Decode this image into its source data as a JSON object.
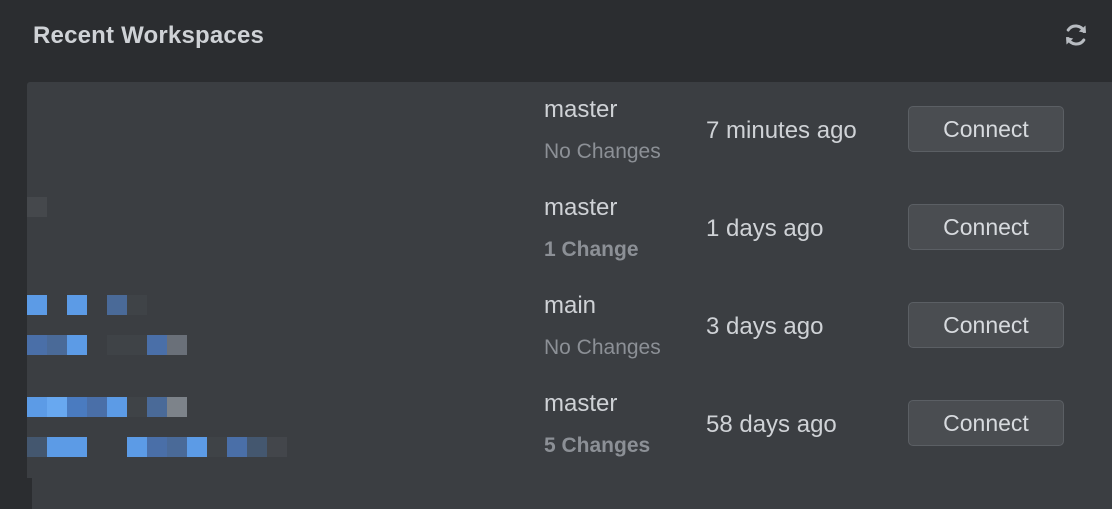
{
  "header": {
    "title": "Recent Workspaces",
    "refresh_icon": "refresh-icon"
  },
  "workspaces": [
    {
      "branch": "master",
      "changes": "No Changes",
      "changes_bold": false,
      "last_used": "7 minutes ago",
      "action_label": "Connect"
    },
    {
      "branch": "master",
      "changes": "1 Change",
      "changes_bold": true,
      "last_used": "1 days ago",
      "action_label": "Connect"
    },
    {
      "branch": "main",
      "changes": "No Changes",
      "changes_bold": false,
      "last_used": "3 days ago",
      "action_label": "Connect"
    },
    {
      "branch": "master",
      "changes": "5 Changes",
      "changes_bold": true,
      "last_used": "58 days ago",
      "action_label": "Connect"
    }
  ],
  "colors": {
    "background": "#2b2d30",
    "panel": "#3b3e42",
    "text_primary": "#cfd2d6",
    "text_secondary": "#8c9096",
    "button_bg": "#4a4d51",
    "redaction_blue": "#5c9be6"
  }
}
